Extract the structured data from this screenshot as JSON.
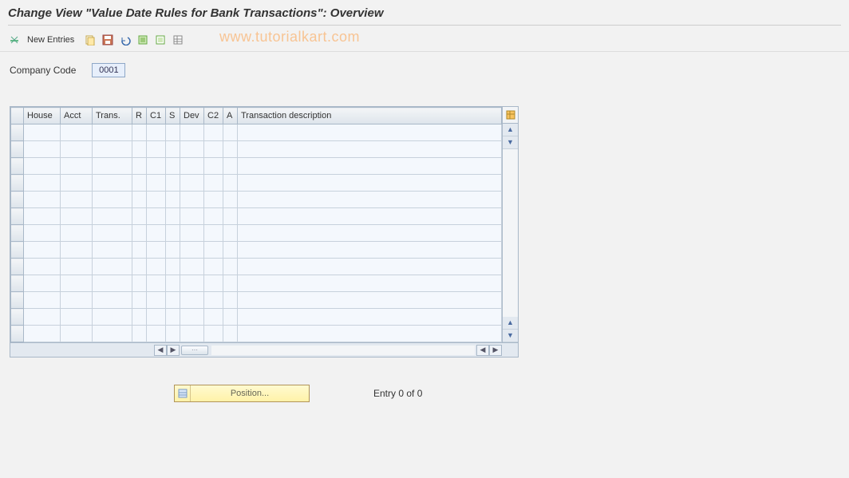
{
  "title": "Change View \"Value Date Rules for Bank Transactions\": Overview",
  "toolbar": {
    "new_entries_label": "New Entries"
  },
  "watermark": "www.tutorialkart.com",
  "fields": {
    "company_code_label": "Company Code",
    "company_code_value": "0001"
  },
  "grid": {
    "columns": [
      "House",
      "Acct",
      "Trans.",
      "R",
      "C1",
      "S",
      "Dev",
      "C2",
      "A",
      "Transaction description"
    ],
    "row_count": 13
  },
  "footer": {
    "position_label": "Position...",
    "entry_status": "Entry 0 of 0"
  }
}
